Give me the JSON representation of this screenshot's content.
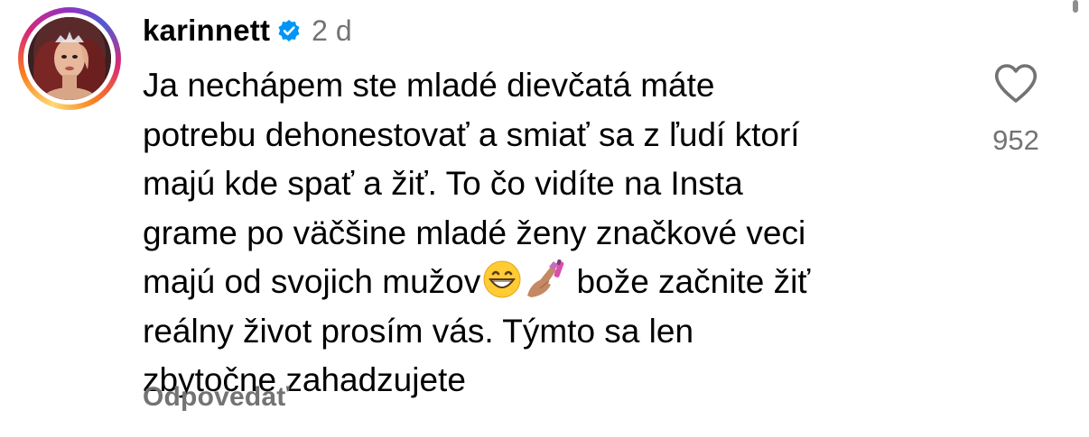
{
  "comment": {
    "username": "karinnett",
    "verified": true,
    "time": "2 d",
    "lines": [
      "Ja nechápem ste mladé dievčatá máte",
      "potrebu dehonestovať a smiať sa z ľudí ktorí",
      "majú kde spať a žiť. To čo vidíte na Insta",
      "grame po väčšine mladé ženy značkové veci",
      "majú od svojich mužov",
      "bože začnite žiť",
      "reálny život prosím vás. Týmto sa len",
      "zbytočne zahadzujete"
    ],
    "emojis": [
      "grinning-face-emoji",
      "nail-polish-emoji"
    ],
    "reply_label": "Odpovedať",
    "like_count": "952"
  },
  "icons": {
    "verified": "verified-badge-icon",
    "like": "heart-outline-icon"
  },
  "colors": {
    "text": "#000000",
    "secondary": "#737373",
    "verified_blue": "#0095f6"
  }
}
